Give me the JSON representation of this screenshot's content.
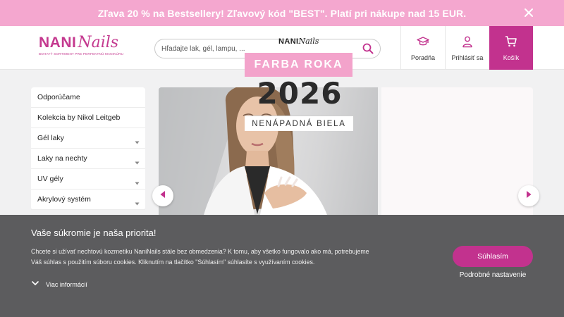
{
  "promo": {
    "text": "Zľava 20 % na Bestsellery! Zľavový kód \"BEST\". Platí pri nákupe nad 15 EUR.",
    "close_icon": "close-icon",
    "background_color": "#f4a7cf"
  },
  "logo": {
    "part1": "NANI",
    "part2": "Nails",
    "tagline": "BOHATÝ SORTIMENT PRE PERFEKTNÚ MANIKÚRU"
  },
  "search": {
    "placeholder": "Hľadajte lak, gél, lampu, ...",
    "value": "",
    "icon": "search-icon"
  },
  "header_nav": {
    "guide": {
      "label": "Poradňa",
      "icon": "graduation-cap-icon"
    },
    "login": {
      "label": "Prihlásiť sa",
      "icon": "user-icon"
    },
    "cart": {
      "label": "Košík",
      "icon": "cart-icon"
    }
  },
  "sidebar": {
    "items": [
      {
        "label": "Odporúčame",
        "has_arrow": false
      },
      {
        "label": "Kolekcia by Nikol Leitgeb",
        "has_arrow": false
      },
      {
        "label": "Gél laky",
        "has_arrow": true
      },
      {
        "label": "Laky na nechty",
        "has_arrow": true
      },
      {
        "label": "UV gély",
        "has_arrow": true
      },
      {
        "label": "Akrylový systém",
        "has_arrow": true
      }
    ]
  },
  "hero": {
    "brand_part1": "NANI",
    "brand_part2": "Nails",
    "headline": "FARBA ROKA",
    "year": "2026",
    "color_name": "NENÁPADNÁ BIELA",
    "prev_icon": "arrow-left-icon",
    "next_icon": "arrow-right-icon"
  },
  "cookie": {
    "title": "Vaše súkromie je naša priorita!",
    "text": "Chcete si užívať nechtovú kozmetiku NaniNails stále bez obmedzenia? K tomu, aby všetko fungovalo ako má, potrebujeme Váš súhlas s použitím súboru cookies. Kliknutím na tlačítko \"Súhlasím\" súhlasíte s využívaním cookies.",
    "more_label": "Viac informácií",
    "accept_label": "Súhlasím",
    "settings_label": "Podrobné nastavenie"
  },
  "colors": {
    "accent": "#c2328e",
    "promo_pink": "#f4a7cf",
    "cookie_bg": "#5c5c5e"
  }
}
